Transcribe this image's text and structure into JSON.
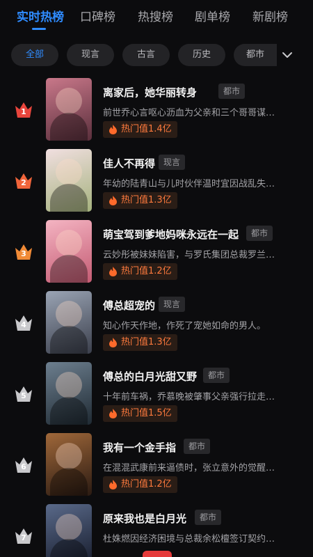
{
  "tabs": [
    {
      "label": "实时热榜",
      "active": true
    },
    {
      "label": "口碑榜",
      "active": false
    },
    {
      "label": "热搜榜",
      "active": false
    },
    {
      "label": "剧单榜",
      "active": false
    },
    {
      "label": "新剧榜",
      "active": false
    }
  ],
  "filters": {
    "chips": [
      {
        "label": "全部",
        "active": true
      },
      {
        "label": "现言",
        "active": false
      },
      {
        "label": "古言",
        "active": false
      },
      {
        "label": "历史",
        "active": false
      },
      {
        "label": "都市",
        "active": false
      }
    ],
    "expand_icon": "chevron-down-icon"
  },
  "list": [
    {
      "rank": "1",
      "title": "离家后，她华丽转身",
      "genre": "都市",
      "desc": "前世乔心言呕心沥血为父亲和三个哥哥谋…",
      "heat": "热门值1.4亿",
      "badge_color": "#e8453c",
      "poster_colors": [
        "#c9788a",
        "#5a2f3c"
      ]
    },
    {
      "rank": "2",
      "title": "佳人不再得",
      "genre": "现言",
      "desc": "年幼的陆青山与儿时伙伴温时宜因战乱失…",
      "heat": "热门值1.3亿",
      "badge_color": "#f0643a",
      "poster_colors": [
        "#f1dfe0",
        "#a5b27e"
      ]
    },
    {
      "rank": "3",
      "title": "萌宝驾到爹地妈咪永远在一起",
      "genre": "都市",
      "desc": "云妙彤被妹妹陷害，与罗氏集团总裁罗兰…",
      "heat": "热门值1.2亿",
      "badge_color": "#f08a36",
      "poster_colors": [
        "#f4b4c2",
        "#c45b73"
      ]
    },
    {
      "rank": "4",
      "title": "傅总超宠的",
      "genre": "现言",
      "desc": "知心作天作地，作死了宠她如命的男人。",
      "heat": "热门值1.3亿",
      "badge_color": "#c9c9cc",
      "poster_colors": [
        "#9aa4b4",
        "#3b3f4c"
      ]
    },
    {
      "rank": "5",
      "title": "傅总的白月光甜又野",
      "genre": "都市",
      "desc": "十年前车祸，乔慕晚被肇事父亲强行拉走…",
      "heat": "热门值1.5亿",
      "badge_color": "#c9c9cc",
      "poster_colors": [
        "#6d7f8f",
        "#1f2a33"
      ]
    },
    {
      "rank": "6",
      "title": "我有一个金手指",
      "genre": "都市",
      "desc": "在混混武康前来逼债时，张立意外的觉醒…",
      "heat": "热门值1.2亿",
      "badge_color": "#c9c9cc",
      "poster_colors": [
        "#a0683a",
        "#2a1a12"
      ]
    },
    {
      "rank": "7",
      "title": "原来我也是白月光",
      "genre": "都市",
      "desc": "杜姝燃因经济困境与总裁余松檀签订契约…",
      "heat": "",
      "badge_color": "#c9c9cc",
      "poster_colors": [
        "#5a6a8a",
        "#151a2a"
      ]
    }
  ]
}
